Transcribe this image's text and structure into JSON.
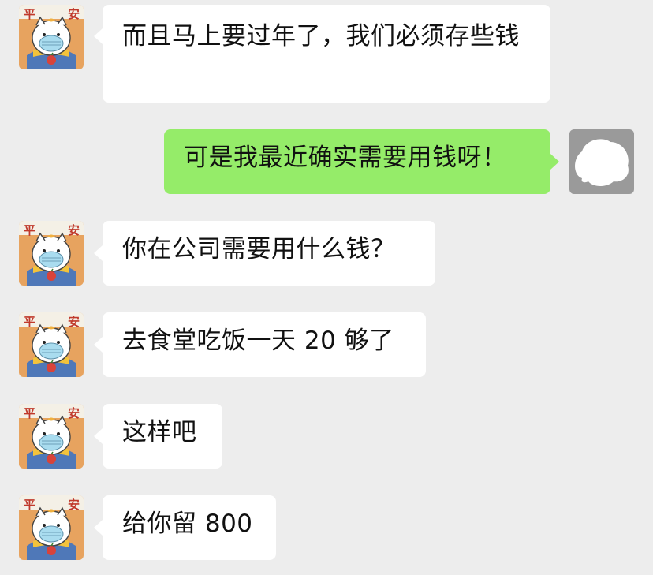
{
  "chat": {
    "background": "#ededed",
    "bubble_in_color": "#ffffff",
    "bubble_out_color": "#95ec69",
    "contact_avatar": {
      "icon": "cat-ping-an-avatar-icon",
      "text": "平安"
    },
    "self_avatar": {
      "icon": "blank-cloud-avatar-icon"
    },
    "messages": [
      {
        "sender": "contact",
        "text": "而且马上要过年了，我们必须存些钱"
      },
      {
        "sender": "me",
        "text": "可是我最近确实需要用钱呀！"
      },
      {
        "sender": "contact",
        "text": "你在公司需要用什么钱？"
      },
      {
        "sender": "contact",
        "text": "去食堂吃饭一天 20 够了"
      },
      {
        "sender": "contact",
        "text": "这样吧"
      },
      {
        "sender": "contact",
        "text": "给你留 800"
      }
    ]
  }
}
